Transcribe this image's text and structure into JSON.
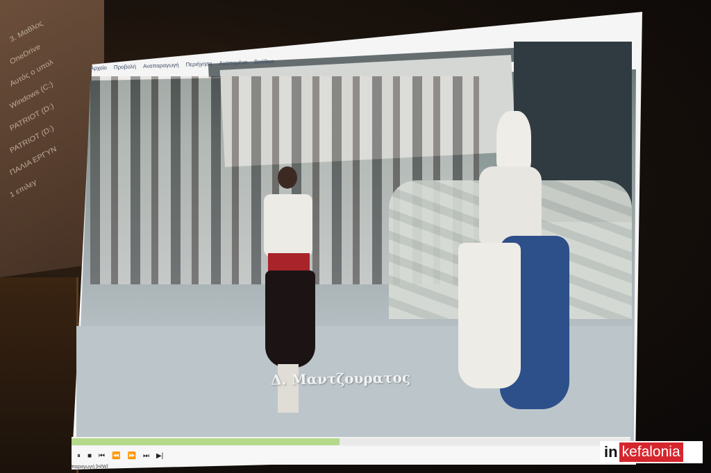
{
  "left_panel": {
    "items": [
      "3. Μαθλος",
      "OneDrive",
      "Αυτός ο υπολ",
      "Windows (C:)",
      "PATRIOT (D:)",
      "PATRIOT (D:)",
      "ΠΑΛΙΑ ΕΡΓΥΝ",
      "1 επιλεγ"
    ]
  },
  "player": {
    "menu": [
      "Αρχείο",
      "Προβολή",
      "Αναπαραγωγή",
      "Περιήγηση",
      "Αγαπημένα",
      "Βοήθεια"
    ],
    "caption": "Δ. Μαντζουρατος",
    "progress": 0.48,
    "controls": [
      "⏸",
      "■",
      "⏮",
      "⏪",
      "⏩",
      "⏭",
      "▶|"
    ],
    "status": "παραγωγή [H/W]"
  },
  "logo": {
    "prefix": "in",
    "name": "kefalonia"
  },
  "colors": {
    "logo_red": "#d6262d",
    "seek_played": "#b4d98a"
  }
}
